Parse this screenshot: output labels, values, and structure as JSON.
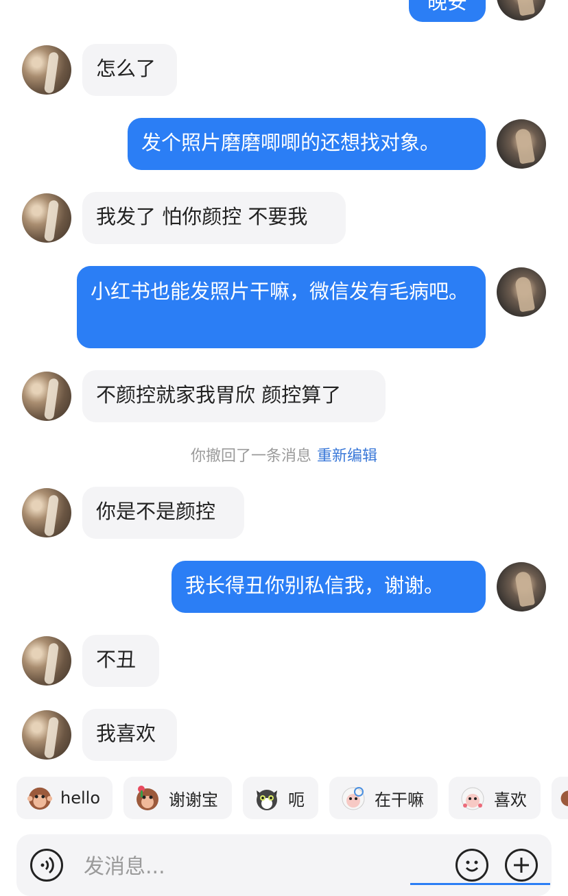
{
  "messages": [
    {
      "side": "me",
      "text": "晚安"
    },
    {
      "side": "them",
      "text": "怎么了"
    },
    {
      "side": "me",
      "text": "发个照片磨磨唧唧的还想找对象。"
    },
    {
      "side": "them",
      "text": "我发了 怕你颜控 不要我"
    },
    {
      "side": "me",
      "text": "小红书也能发照片干嘛，微信发有毛病吧。"
    },
    {
      "side": "them",
      "text": "不颜控就家我胃欣 颜控算了"
    },
    {
      "side": "them",
      "text": "你是不是颜控"
    },
    {
      "side": "me",
      "text": "我长得丑你别私信我，谢谢。"
    },
    {
      "side": "them",
      "text": "不丑"
    },
    {
      "side": "them",
      "text": "我喜欢"
    }
  ],
  "system_notice": {
    "text": "你撤回了一条消息",
    "action": "重新编辑"
  },
  "quick_replies": [
    {
      "label": "hello",
      "icon": "monkey-hello-icon"
    },
    {
      "label": "谢谢宝",
      "icon": "monkey-flower-icon"
    },
    {
      "label": "呃",
      "icon": "cat-face-icon"
    },
    {
      "label": "在干嘛",
      "icon": "sheep-wondering-icon"
    },
    {
      "label": "喜欢",
      "icon": "sheep-love-icon"
    }
  ],
  "input": {
    "placeholder": "发消息..."
  },
  "colors": {
    "accent": "#2b7ef5",
    "bubble_them": "#f4f4f6",
    "link": "#3a78d8"
  }
}
